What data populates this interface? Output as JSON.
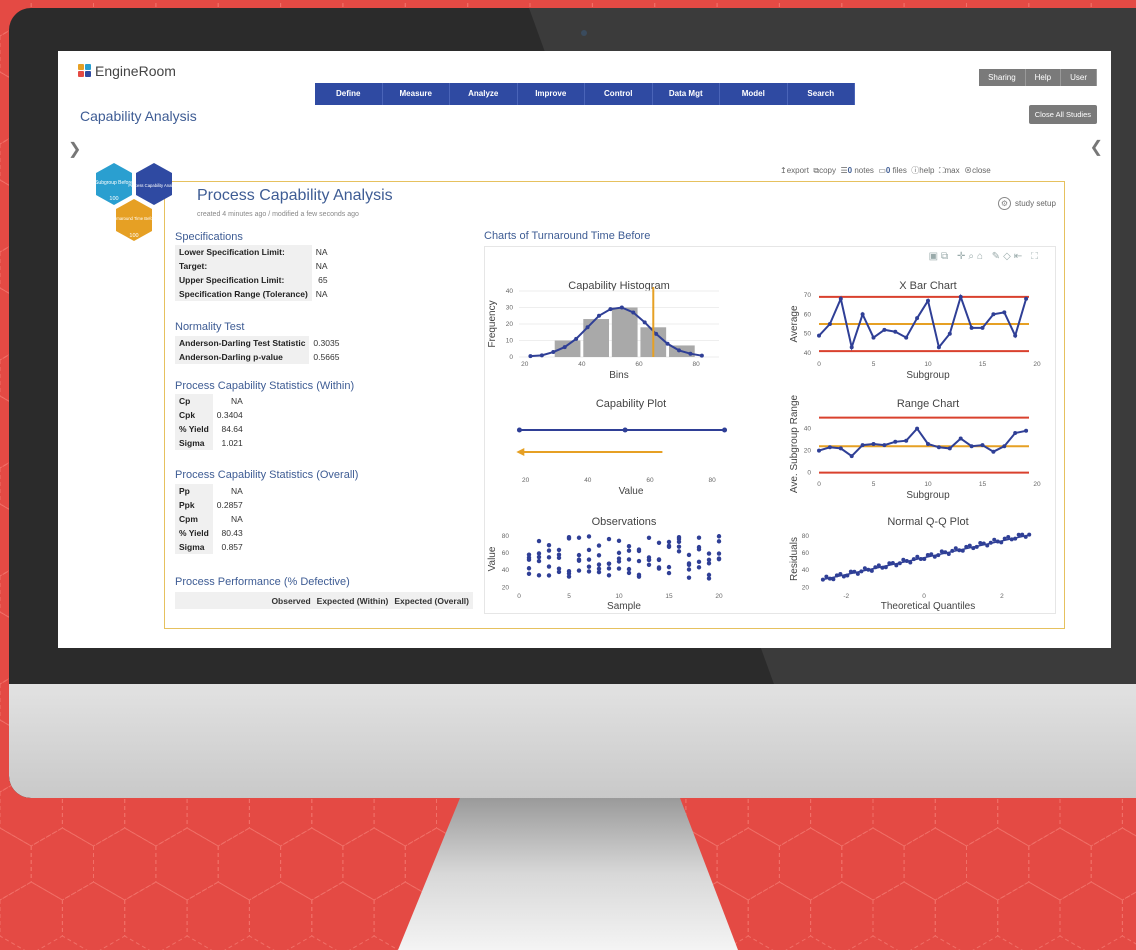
{
  "app": {
    "logo": "EngineRoom",
    "page_title": "Capability Analysis"
  },
  "nav": [
    "Define",
    "Measure",
    "Analyze",
    "Improve",
    "Control",
    "Data Mgt",
    "Model",
    "Search"
  ],
  "top_buttons": [
    "Sharing",
    "Help",
    "User"
  ],
  "close_all": "Close All Studies",
  "study_toolbar": {
    "export": "export",
    "copy": "copy",
    "notes_count": "0",
    "notes": "notes",
    "files_count": "0",
    "files": "files",
    "help": "help",
    "max": "max",
    "close": "close"
  },
  "hex_nodes": [
    {
      "label": "Subgroup Before",
      "count": "100",
      "color": "#2a9fd0"
    },
    {
      "label": "Process Capability Analysis",
      "count": "",
      "color": "#2f4aa2"
    },
    {
      "label": "Turnaround Time Before",
      "count": "100",
      "color": "#e6a024"
    }
  ],
  "study": {
    "title": "Process Capability Analysis",
    "subtitle": "created 4 minutes ago / modified a few seconds ago",
    "setup": "study setup"
  },
  "specifications": {
    "title": "Specifications",
    "rows": [
      {
        "k": "Lower Specification Limit:",
        "v": "NA"
      },
      {
        "k": "Target:",
        "v": "NA"
      },
      {
        "k": "Upper Specification Limit:",
        "v": "65"
      },
      {
        "k": "Specification Range (Tolerance)",
        "v": "NA"
      }
    ]
  },
  "normality": {
    "title": "Normality Test",
    "rows": [
      {
        "k": "Anderson-Darling Test Statistic",
        "v": "0.3035"
      },
      {
        "k": "Anderson-Darling p-value",
        "v": "0.5665"
      }
    ]
  },
  "within": {
    "title": "Process Capability Statistics (Within)",
    "rows": [
      {
        "k": "Cp",
        "v": "NA"
      },
      {
        "k": "Cpk",
        "v": "0.3404"
      },
      {
        "k": "% Yield",
        "v": "84.64"
      },
      {
        "k": "Sigma",
        "v": "1.021"
      }
    ]
  },
  "overall": {
    "title": "Process Capability Statistics (Overall)",
    "rows": [
      {
        "k": "Pp",
        "v": "NA"
      },
      {
        "k": "Ppk",
        "v": "0.2857"
      },
      {
        "k": "Cpm",
        "v": "NA"
      },
      {
        "k": "% Yield",
        "v": "80.43"
      },
      {
        "k": "Sigma",
        "v": "0.857"
      }
    ]
  },
  "performance": {
    "title": "Process Performance (% Defective)",
    "headers": [
      "Observed",
      "Expected (Within)",
      "Expected (Overall)"
    ]
  },
  "charts_title": "Charts of Turnaround Time Before",
  "chart_data": [
    {
      "type": "bar",
      "title": "Capability Histogram",
      "xlabel": "Bins",
      "ylabel": "Frequency",
      "categories": [
        35,
        45,
        55,
        65,
        75
      ],
      "values": [
        10,
        23,
        30,
        18,
        7
      ],
      "xlim": [
        18,
        88
      ],
      "ylim": [
        0,
        40
      ],
      "usl": 65,
      "curve": {
        "x": [
          22,
          26,
          30,
          34,
          38,
          42,
          46,
          50,
          54,
          58,
          62,
          66,
          70,
          74,
          78,
          82
        ],
        "y": [
          0.5,
          1,
          3,
          6,
          11,
          18,
          25,
          29,
          30,
          27,
          21,
          14,
          8,
          4,
          2,
          0.8
        ]
      }
    },
    {
      "type": "line",
      "title": "X Bar Chart",
      "xlabel": "Subgroup",
      "ylabel": "Average",
      "x": [
        0,
        1,
        2,
        3,
        4,
        5,
        6,
        7,
        8,
        9,
        10,
        11,
        12,
        13,
        14,
        15,
        16,
        17,
        18,
        19
      ],
      "values": [
        49,
        55,
        68,
        43,
        60,
        48,
        52,
        51,
        48,
        58,
        67,
        43,
        50,
        69,
        53,
        53,
        60,
        61,
        49,
        68
      ],
      "limits": {
        "ucl": 69,
        "center": 55,
        "lcl": 41
      },
      "xlim": [
        0,
        20
      ],
      "ylim": [
        38,
        72
      ]
    },
    {
      "type": "scatter",
      "title": "Capability Plot",
      "xlabel": "Value",
      "within": {
        "from": 18,
        "to": 84,
        "mid": 52
      },
      "overall": {
        "from": 17,
        "to": 64
      },
      "xlim": [
        14,
        88
      ]
    },
    {
      "type": "line",
      "title": "Range Chart",
      "xlabel": "Subgroup",
      "ylabel": "Ave. Subgroup Range",
      "x": [
        0,
        1,
        2,
        3,
        4,
        5,
        6,
        7,
        8,
        9,
        10,
        11,
        12,
        13,
        14,
        15,
        16,
        17,
        18,
        19
      ],
      "values": [
        20,
        23,
        22,
        15,
        25,
        26,
        25,
        28,
        29,
        40,
        26,
        23,
        22,
        31,
        24,
        25,
        19,
        24,
        36,
        38
      ],
      "limits": {
        "ucl": 50,
        "center": 24,
        "lcl": 0
      },
      "xlim": [
        0,
        20
      ],
      "ylim": [
        -4,
        56
      ]
    },
    {
      "type": "scatter",
      "title": "Observations",
      "xlabel": "Sample",
      "ylabel": "Value",
      "xlim": [
        0,
        21
      ],
      "ylim": [
        18,
        88
      ]
    },
    {
      "type": "scatter",
      "title": "Normal Q-Q Plot",
      "xlabel": "Theoretical Quantiles",
      "ylabel": "Residuals",
      "xlim": [
        -2.7,
        2.9
      ],
      "ylim": [
        18,
        88
      ]
    }
  ]
}
